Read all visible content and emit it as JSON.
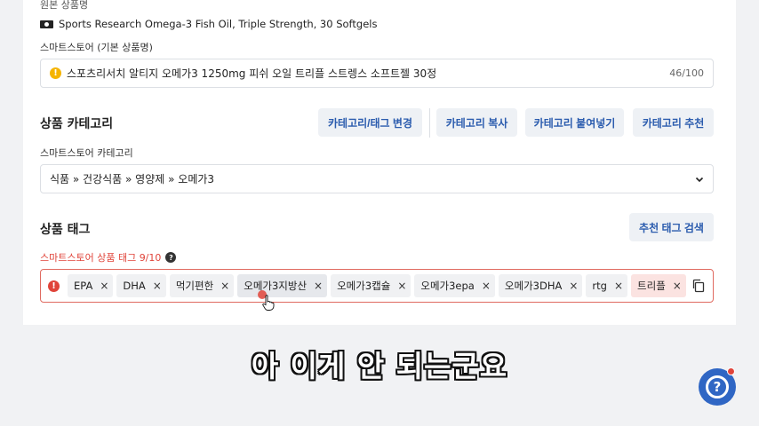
{
  "original_name": {
    "label": "원본 상품명",
    "value": "Sports Research Omega-3 Fish Oil, Triple Strength, 30 Softgels"
  },
  "smartstore_name": {
    "label": "스마트스토어 (기본 상품명)",
    "value": "스포츠리서치 알티지 오메가3 1250mg 피쉬 오일 트리플 스트렝스 소프트젤 30정",
    "count": "46/100",
    "warn_icon": "!"
  },
  "category": {
    "title": "상품 카테고리",
    "buttons": [
      "카테고리/태그 변경",
      "카테고리 복사",
      "카테고리 붙여넣기",
      "카테고리 추천"
    ],
    "label": "스마트스토어 카테고리",
    "value": "식품 » 건강식품 » 영양제 » 오메가3"
  },
  "tags": {
    "title": "상품 태그",
    "search_button": "추천 태그 검색",
    "label": "스마트스토어 상품 태그 9/10",
    "help_icon": "?",
    "error_icon": "!",
    "remove_glyph": "×",
    "items": [
      "EPA",
      "DHA",
      "먹기편한",
      "오메가3지방산",
      "오메가3캡슐",
      "오메가3epa",
      "오메가3DHA",
      "rtg",
      "트리플"
    ]
  },
  "subtitle": "아 이게 안 되는군요",
  "help_fab_glyph": "?",
  "colors": {
    "accent": "#2b5cae",
    "error": "#e0443a",
    "warn": "#f5b400",
    "fab": "#2f66c4"
  }
}
